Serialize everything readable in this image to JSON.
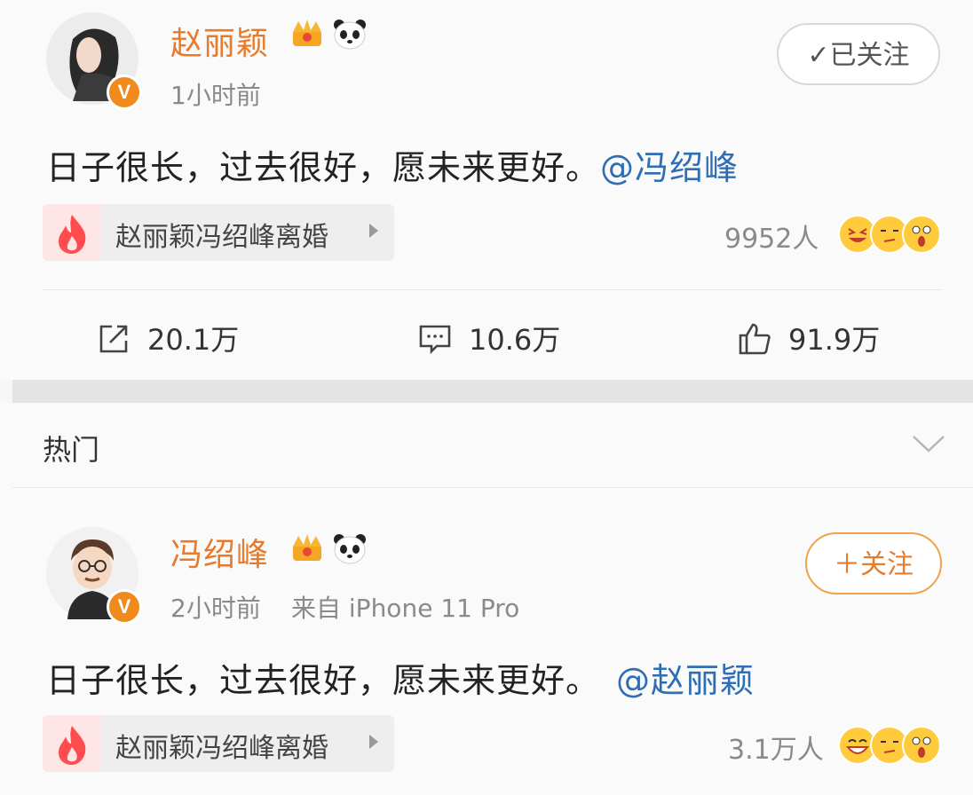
{
  "post1": {
    "username": "赵丽颖",
    "time": "1小时前",
    "text": "日子很长，过去很好，愿未来更好。",
    "mention": "@冯绍峰",
    "follow_label": "✓已关注",
    "topic": "赵丽颖冯绍峰离婚",
    "reaction_count": "9952人",
    "actions": {
      "share": "20.1万",
      "comment": "10.6万",
      "like": "91.9万"
    }
  },
  "section": {
    "title": "热门"
  },
  "post2": {
    "username": "冯绍峰",
    "time": "2小时前",
    "source": "来自 iPhone 11 Pro",
    "text": "日子很长，过去很好，愿未来更好。",
    "mention": "@赵丽颖",
    "follow_label": "＋关注",
    "topic": "赵丽颖冯绍峰离婚",
    "reaction_count": "3.1万人"
  },
  "verified_badge": "V",
  "colors": {
    "username": "#e87b2b",
    "mention": "#2f6db5",
    "badge": "#f08a1c"
  }
}
